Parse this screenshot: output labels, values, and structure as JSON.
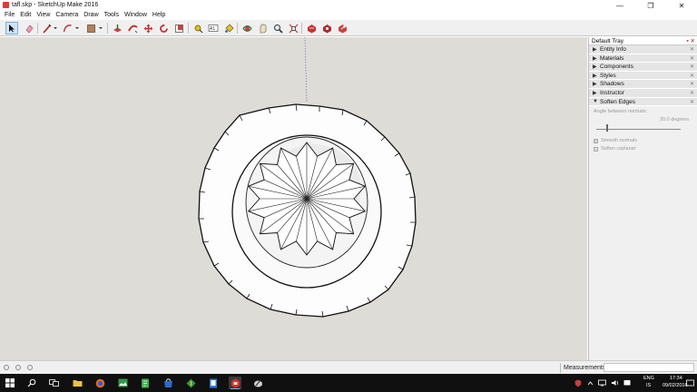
{
  "window": {
    "title": "tafl.skp - SketchUp Make 2016",
    "minimize": "—",
    "maximize": "❐",
    "close": "✕"
  },
  "menu": [
    "File",
    "Edit",
    "View",
    "Camera",
    "Draw",
    "Tools",
    "Window",
    "Help"
  ],
  "toolbar": {
    "tools": [
      "select",
      "eraser",
      "line",
      "arc",
      "shapes",
      "paint-bucket",
      "push-pull",
      "follow-me",
      "move",
      "rotate",
      "scale",
      "offset",
      "tape-measure",
      "text",
      "paint",
      "orbit",
      "pan",
      "zoom",
      "zoom-extents",
      "warehouse",
      "extension-warehouse",
      "share"
    ]
  },
  "tray": {
    "title": "Default Tray",
    "header_buttons": "▪ ✕",
    "panels": [
      {
        "label": "Entity Info",
        "expanded": false
      },
      {
        "label": "Materials",
        "expanded": false
      },
      {
        "label": "Components",
        "expanded": false
      },
      {
        "label": "Styles",
        "expanded": false
      },
      {
        "label": "Shadows",
        "expanded": false
      },
      {
        "label": "Instructor",
        "expanded": false
      },
      {
        "label": "Soften Edges",
        "expanded": true
      }
    ],
    "soften_edges": {
      "angle_label": "Angle between normals:",
      "angle_value": "20.0 degrees",
      "slider_fraction": 0.12,
      "smooth_normals": "Smooth normals",
      "soften_coplanar": "Soften coplanar"
    }
  },
  "status": {
    "measurements_label": "Measurements",
    "measurements_value": ""
  },
  "taskbar": {
    "language_top": "ENG",
    "language_bottom": "IS",
    "time": "17:34",
    "date": "09/02/2016"
  },
  "colors": {
    "viewport_bg": "#dedcd6",
    "taskbar_bg": "#101010",
    "accent": "#7ab8ff",
    "sketchup_red": "#d8322c"
  }
}
